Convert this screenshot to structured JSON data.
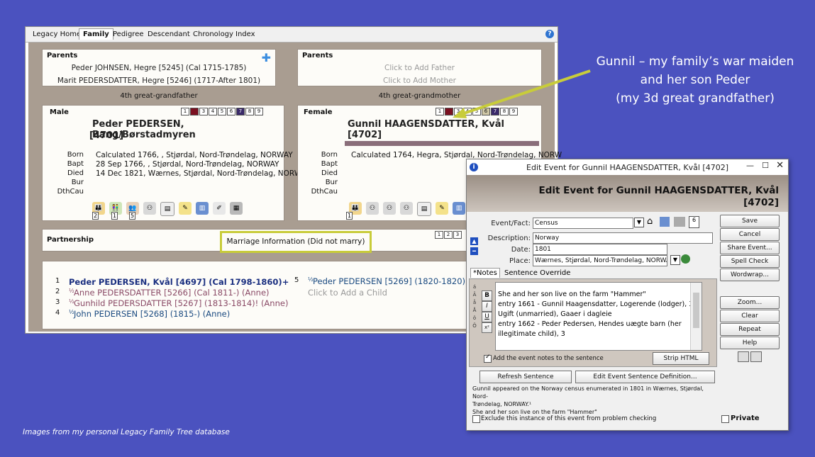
{
  "annotation": {
    "lines": [
      "Gunnil – my family’s war maiden",
      "and her son Peder",
      "(my 3d great grandfather)"
    ],
    "footer": "Images from my personal Legacy Family Tree database"
  },
  "main_window": {
    "tabs": [
      "Legacy Home",
      "Family",
      "Pedigree",
      "Descendant",
      "Chronology",
      "Index"
    ],
    "active_tab": "Family",
    "left_parents": {
      "title": "Parents",
      "father": "Peder JOHNSEN, Hegre [5245] (Cal 1715-1785)",
      "mother": "Marit PEDERSDATTER, Hegre [5246] (1717-After 1801)"
    },
    "right_parents": {
      "title": "Parents",
      "father": "Click to Add Father",
      "mother": "Click to Add Mother"
    },
    "left_generation": "4th great-grandfather",
    "right_generation": "4th great-grandmother",
    "male": {
      "label": "Male",
      "name_line1": "Peder PEDERSEN, Bang/Børstadmyren",
      "name_line2": "[4701]",
      "boxes": [
        "1",
        "2",
        "3",
        "4",
        "5",
        "6",
        "7",
        "8",
        "9"
      ],
      "events": [
        {
          "label": "Born",
          "value": "Calculated 1766, , Stjørdal, Nord-Trøndelag, NORWAY"
        },
        {
          "label": "Bapt",
          "value": "28 Sep 1766, , Stjørdal, Nord-Trøndelag, NORWAY"
        },
        {
          "label": "Died",
          "value": "14 Dec 1821, Wærnes, Stjørdal, Nord-Trøndelag, NORW"
        },
        {
          "label": "Bur",
          "value": ""
        },
        {
          "label": "DthCau",
          "value": ""
        }
      ],
      "badge_2": "2",
      "badge_1": "1",
      "badge_5": "5"
    },
    "female": {
      "label": "Female",
      "name_line1": "Gunnil HAAGENSDATTER, Kvål [4702]",
      "boxes": [
        "1",
        "2",
        "3",
        "4",
        "5",
        "6",
        "7",
        "8",
        "9"
      ],
      "events": [
        {
          "label": "Born",
          "value": "Calculated 1764, Hegra, Stjørdal, Nord-Trøndelag, NORW"
        },
        {
          "label": "Bapt",
          "value": ""
        },
        {
          "label": "Died",
          "value": ""
        },
        {
          "label": "Bur",
          "value": ""
        },
        {
          "label": "DthCau",
          "value": ""
        }
      ],
      "badge_1": "1"
    },
    "partnership": {
      "title": "Partnership",
      "marriage": "Marriage Information (Did not marry)",
      "boxes": [
        "1",
        "2",
        "3"
      ]
    },
    "children": [
      {
        "num": "1",
        "text": "Peder PEDERSEN, Kvål [4697] (Cal 1798-1860)+",
        "color": "#1a2f80"
      },
      {
        "num": "2",
        "text": "Anne PEDERSDATTER [5266] (Cal 1811-) (Anne)",
        "color": "#8a4a66"
      },
      {
        "num": "3",
        "text": "Gunhild PEDERSDATTER [5267] (1813-1814)! (Anne)",
        "color": "#8a4a66"
      },
      {
        "num": "4",
        "text": "John PEDERSEN [5268] (1815-) (Anne)",
        "color": "#1a4a80"
      },
      {
        "num": "5",
        "text": "Peder PEDERSEN [5269] (1820-1820)! (Ann",
        "color": "#1a4a80"
      }
    ],
    "add_child": "Click to Add a Child",
    "half_sign": "½"
  },
  "dialog": {
    "title": "Edit Event for Gunnil HAAGENSDATTER, Kvål [4702]",
    "header_line1": "Edit Event for Gunnil HAAGENSDATTER, Kvål",
    "header_line2": "[4702]",
    "fields": {
      "event_label": "Event/Fact:",
      "event_value": "Census",
      "description_label": "Description:",
      "description_value": "Norway",
      "date_label": "Date:",
      "date_value": "1801",
      "place_label": "Place:",
      "place_value": "Wærnes, Stjørdal, Nord-Trøndelag, NORWAY"
    },
    "notes_tabs": [
      "*Notes",
      "Sentence Override"
    ],
    "format_buttons": [
      "B",
      "I",
      "U",
      "x²"
    ],
    "side_chars": [
      "á",
      "Â",
      "å",
      "Å",
      "ö",
      "Ö"
    ],
    "notes_lines": [
      "She and her son live on the farm \"Hammer\"",
      "entry 1661 - Gunnil Haagensdatter, Logerende (lodger), 37,",
      "Ugift (unmarried), Gaaer i dagleie",
      "entry 1662 - Peder Pedersen, Hendes uægte barn (her",
      "illegitimate child), 3"
    ],
    "add_notes_label": "Add the event notes to the sentence",
    "strip_html": "Strip HTML",
    "refresh_sentence": "Refresh Sentence",
    "edit_sentence_def": "Edit Event Sentence Definition...",
    "sentence_lines": [
      "Gunnil appeared on the Norway census enumerated in 1801 in Wærnes, Stjørdal, Nord-",
      "Trøndelag, NORWAY.¹",
      "She and her son live on the farm \"Hammer\""
    ],
    "exclude_label": "Exclude this instance of this event from problem checking",
    "private_label": "Private",
    "right_buttons": [
      "Save",
      "Cancel",
      "Share Event...",
      "Spell Check",
      "Wordwrap...",
      "Zoom...",
      "Clear",
      "Repeat",
      "Help"
    ],
    "info_icon": "i"
  },
  "colors": {
    "background": "#4b52bf",
    "highlight_box": "#c8cc3a",
    "arrow": "#c8cc3a",
    "male_name": "#222222"
  }
}
